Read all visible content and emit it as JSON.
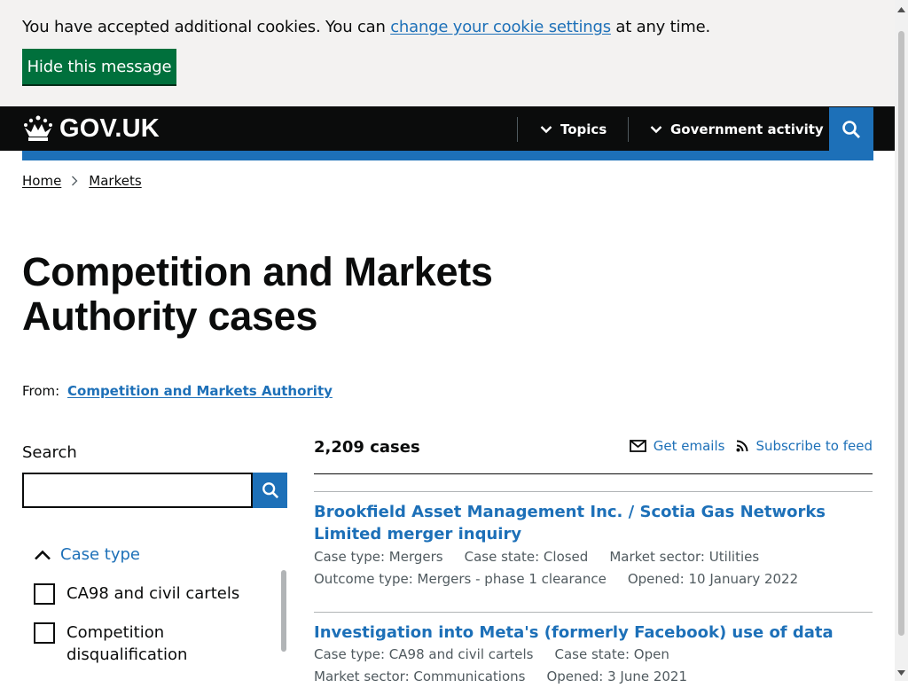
{
  "cookie_banner": {
    "text_before": "You have accepted additional cookies. You can ",
    "link_text": "change your cookie settings",
    "text_after": " at any time.",
    "hide_button": "Hide this message"
  },
  "header": {
    "logo_text": "GOV.UK",
    "nav": [
      {
        "label": "Topics"
      },
      {
        "label": "Government activity"
      }
    ],
    "search_icon": "search-icon"
  },
  "breadcrumb": [
    {
      "label": "Home"
    },
    {
      "label": "Markets"
    }
  ],
  "page": {
    "title": "Competition and Markets Authority cases",
    "from_label": "From:",
    "from_link": "Competition and Markets Authority"
  },
  "sidebar": {
    "search_label": "Search",
    "search_value": "",
    "facet": {
      "title": "Case type",
      "options": [
        {
          "label": "CA98 and civil cartels",
          "checked": false
        },
        {
          "label": "Competition disqualification",
          "checked": false
        }
      ]
    }
  },
  "results": {
    "count": "2,209 cases",
    "get_emails": "Get emails",
    "subscribe": "Subscribe to feed",
    "items": [
      {
        "title": "Brookfield Asset Management Inc. / Scotia Gas Networks Limited merger inquiry",
        "meta": [
          "Case type: Mergers",
          "Case state: Closed",
          "Market sector: Utilities",
          "Outcome type: Mergers - phase 1 clearance",
          "Opened: 10 January 2022"
        ]
      },
      {
        "title": "Investigation into Meta's (formerly Facebook) use of data",
        "meta": [
          "Case type: CA98 and civil cartels",
          "Case state: Open",
          "Market sector: Communications",
          "Opened: 3 June 2021"
        ]
      }
    ]
  },
  "colors": {
    "brand_blue": "#1d70b8",
    "header_black": "#0b0c0c",
    "button_green": "#00703c",
    "banner_bg": "#f3f2f1"
  }
}
